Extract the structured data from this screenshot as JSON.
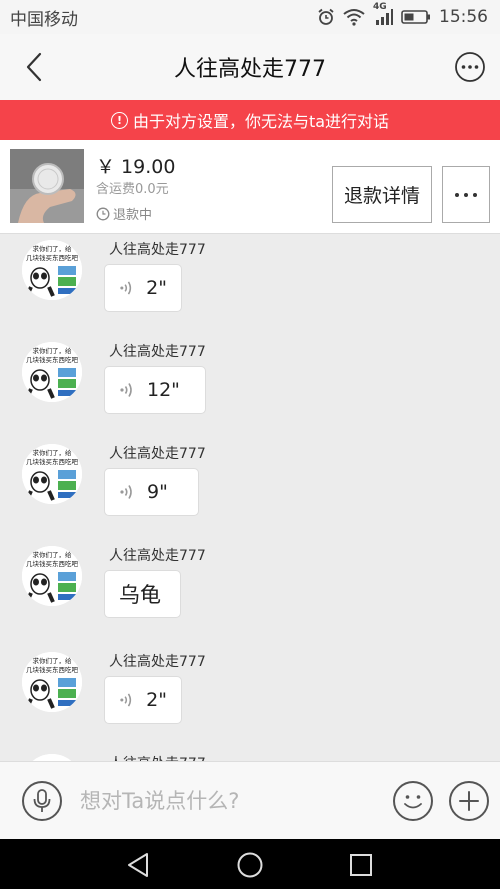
{
  "status_bar": {
    "carrier": "中国移动",
    "network": "4G",
    "time": "15:56"
  },
  "header": {
    "title": "人往高处走777"
  },
  "warning": {
    "text": "由于对方设置，你无法与ta进行对话",
    "icon_glyph": "!"
  },
  "product": {
    "price": "￥ 19.00",
    "shipping": "含运费0.0元",
    "status": "退款中",
    "refund_button": "退款详情"
  },
  "messages": [
    {
      "sender": "人往高处走777",
      "type": "voice",
      "duration": "2\""
    },
    {
      "sender": "人往高处走777",
      "type": "voice",
      "duration": "12\""
    },
    {
      "sender": "人往高处走777",
      "type": "voice",
      "duration": "9\""
    },
    {
      "sender": "人往高处走777",
      "type": "text",
      "text": "乌龟"
    },
    {
      "sender": "人往高处走777",
      "type": "voice",
      "duration": "2\""
    },
    {
      "sender": "人往高处走777",
      "type": "voice",
      "duration": ""
    }
  ],
  "avatar_caption": {
    "line1": "求你们了，给",
    "line2": "几块钱买东西吃吧"
  },
  "input": {
    "placeholder": "想对Ta说点什么?"
  },
  "colors": {
    "warning_bg": "#f5434a",
    "chat_bg": "#ececec",
    "nav_bg": "#f7f7f7"
  },
  "icons": [
    "back-arrow-icon",
    "more-horizontal-icon",
    "exclamation-circle-icon",
    "clock-icon",
    "voice-wave-icon",
    "microphone-icon",
    "emoji-smile-icon",
    "plus-icon",
    "nav-back-triangle-icon",
    "nav-home-circle-icon",
    "nav-recents-square-icon"
  ]
}
